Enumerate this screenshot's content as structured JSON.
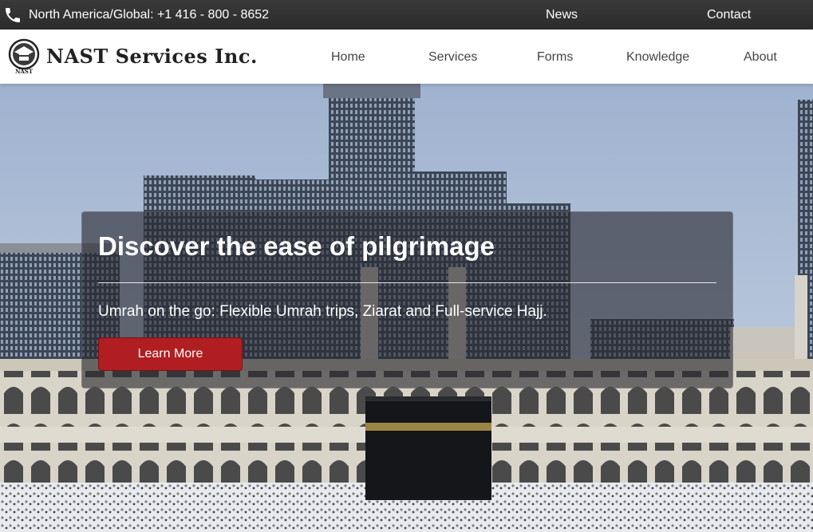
{
  "topbar": {
    "phone_text": "North America/Global: +1 416 - 800 - 8652",
    "links": {
      "news": "News",
      "contact": "Contact"
    },
    "background": "#2f2f2f"
  },
  "brand": {
    "name": "NAST Services Inc.",
    "emblem_text": "NAST"
  },
  "nav": {
    "home": "Home",
    "services": "Services",
    "forms": "Forms",
    "knowledge": "Knowledge",
    "about": "About"
  },
  "hero": {
    "title": "Discover the ease of pilgrimage",
    "subtitle": "Umrah on the go: Flexible Umrah trips, Ziarat and Full-service Hajj.",
    "button_label": "Learn More",
    "button_color": "#b01e22"
  },
  "icons": {
    "phone": "phone-icon",
    "logo": "nast-emblem-icon"
  }
}
